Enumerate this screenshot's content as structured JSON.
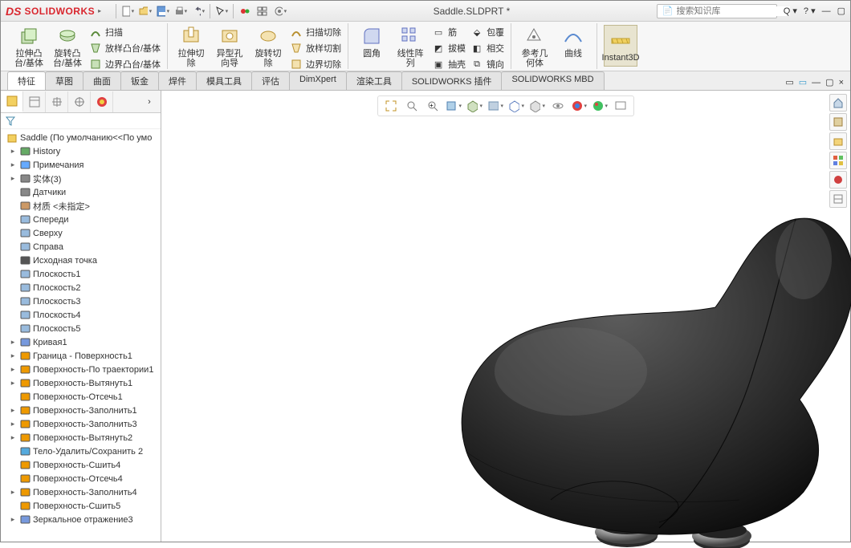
{
  "app": {
    "brand_prefix": "DS",
    "brand": "SOLIDWORKS",
    "doc_title": "Saddle.SLDPRT *",
    "search_placeholder": "搜索知识库"
  },
  "ribbon": {
    "g1": {
      "b1": "拉伸凸台/基体",
      "b2": "旋转凸台/基体",
      "s1": "扫描",
      "s2": "放样凸台/基体",
      "s3": "边界凸台/基体"
    },
    "g2": {
      "b1": "拉伸切除",
      "b2": "异型孔向导",
      "b3": "旋转切除",
      "s1": "扫描切除",
      "s2": "放样切割",
      "s3": "边界切除"
    },
    "g3": {
      "b1": "圆角",
      "b2": "线性阵列",
      "s1": "筋",
      "s2": "拔模",
      "s3": "抽壳",
      "s4": "包覆",
      "s5": "相交",
      "s6": "镜向"
    },
    "g4": {
      "b1": "参考几何体",
      "b2": "曲线"
    },
    "g5": {
      "b1": "Instant3D"
    }
  },
  "tabs": [
    "特征",
    "草图",
    "曲面",
    "钣金",
    "焊件",
    "模具工具",
    "评估",
    "DimXpert",
    "渲染工具",
    "SOLIDWORKS 插件",
    "SOLIDWORKS MBD"
  ],
  "tree_root": "Saddle  (По умолчанию<<По умо",
  "tree": [
    {
      "t": "History",
      "tw": "▸",
      "c": "#6a6"
    },
    {
      "t": "Примечания",
      "tw": "▸",
      "c": "#6af"
    },
    {
      "t": "实体(3)",
      "tw": "▸",
      "c": "#888"
    },
    {
      "t": "Датчики",
      "tw": "",
      "c": "#888"
    },
    {
      "t": "材质 <未指定>",
      "tw": "",
      "c": "#c96"
    },
    {
      "t": "Спереди",
      "tw": "",
      "c": "#9bd"
    },
    {
      "t": "Сверху",
      "tw": "",
      "c": "#9bd"
    },
    {
      "t": "Справа",
      "tw": "",
      "c": "#9bd"
    },
    {
      "t": "Исходная точка",
      "tw": "",
      "c": "#555"
    },
    {
      "t": "Плоскость1",
      "tw": "",
      "c": "#9bd"
    },
    {
      "t": "Плоскость2",
      "tw": "",
      "c": "#9bd"
    },
    {
      "t": "Плоскость3",
      "tw": "",
      "c": "#9bd"
    },
    {
      "t": "Плоскость4",
      "tw": "",
      "c": "#9bd"
    },
    {
      "t": "Плоскость5",
      "tw": "",
      "c": "#9bd"
    },
    {
      "t": "Кривая1",
      "tw": "▸",
      "c": "#79d"
    },
    {
      "t": "Граница - Поверхность1",
      "tw": "▸",
      "c": "#e90"
    },
    {
      "t": "Поверхность-По траектории1",
      "tw": "▸",
      "c": "#e90"
    },
    {
      "t": "Поверхность-Вытянуть1",
      "tw": "▸",
      "c": "#e90"
    },
    {
      "t": "Поверхность-Отсечь1",
      "tw": "",
      "c": "#e90"
    },
    {
      "t": "Поверхность-Заполнить1",
      "tw": "▸",
      "c": "#e90"
    },
    {
      "t": "Поверхность-Заполнить3",
      "tw": "▸",
      "c": "#e90"
    },
    {
      "t": "Поверхность-Вытянуть2",
      "tw": "▸",
      "c": "#e90"
    },
    {
      "t": "Тело-Удалить/Сохранить 2",
      "tw": "",
      "c": "#5ad"
    },
    {
      "t": "Поверхность-Сшить4",
      "tw": "",
      "c": "#e90"
    },
    {
      "t": "Поверхность-Отсечь4",
      "tw": "",
      "c": "#e90"
    },
    {
      "t": "Поверхность-Заполнить4",
      "tw": "▸",
      "c": "#e90"
    },
    {
      "t": "Поверхность-Сшить5",
      "tw": "",
      "c": "#e90"
    },
    {
      "t": "Зеркальное отражение3",
      "tw": "▸",
      "c": "#79d"
    }
  ]
}
